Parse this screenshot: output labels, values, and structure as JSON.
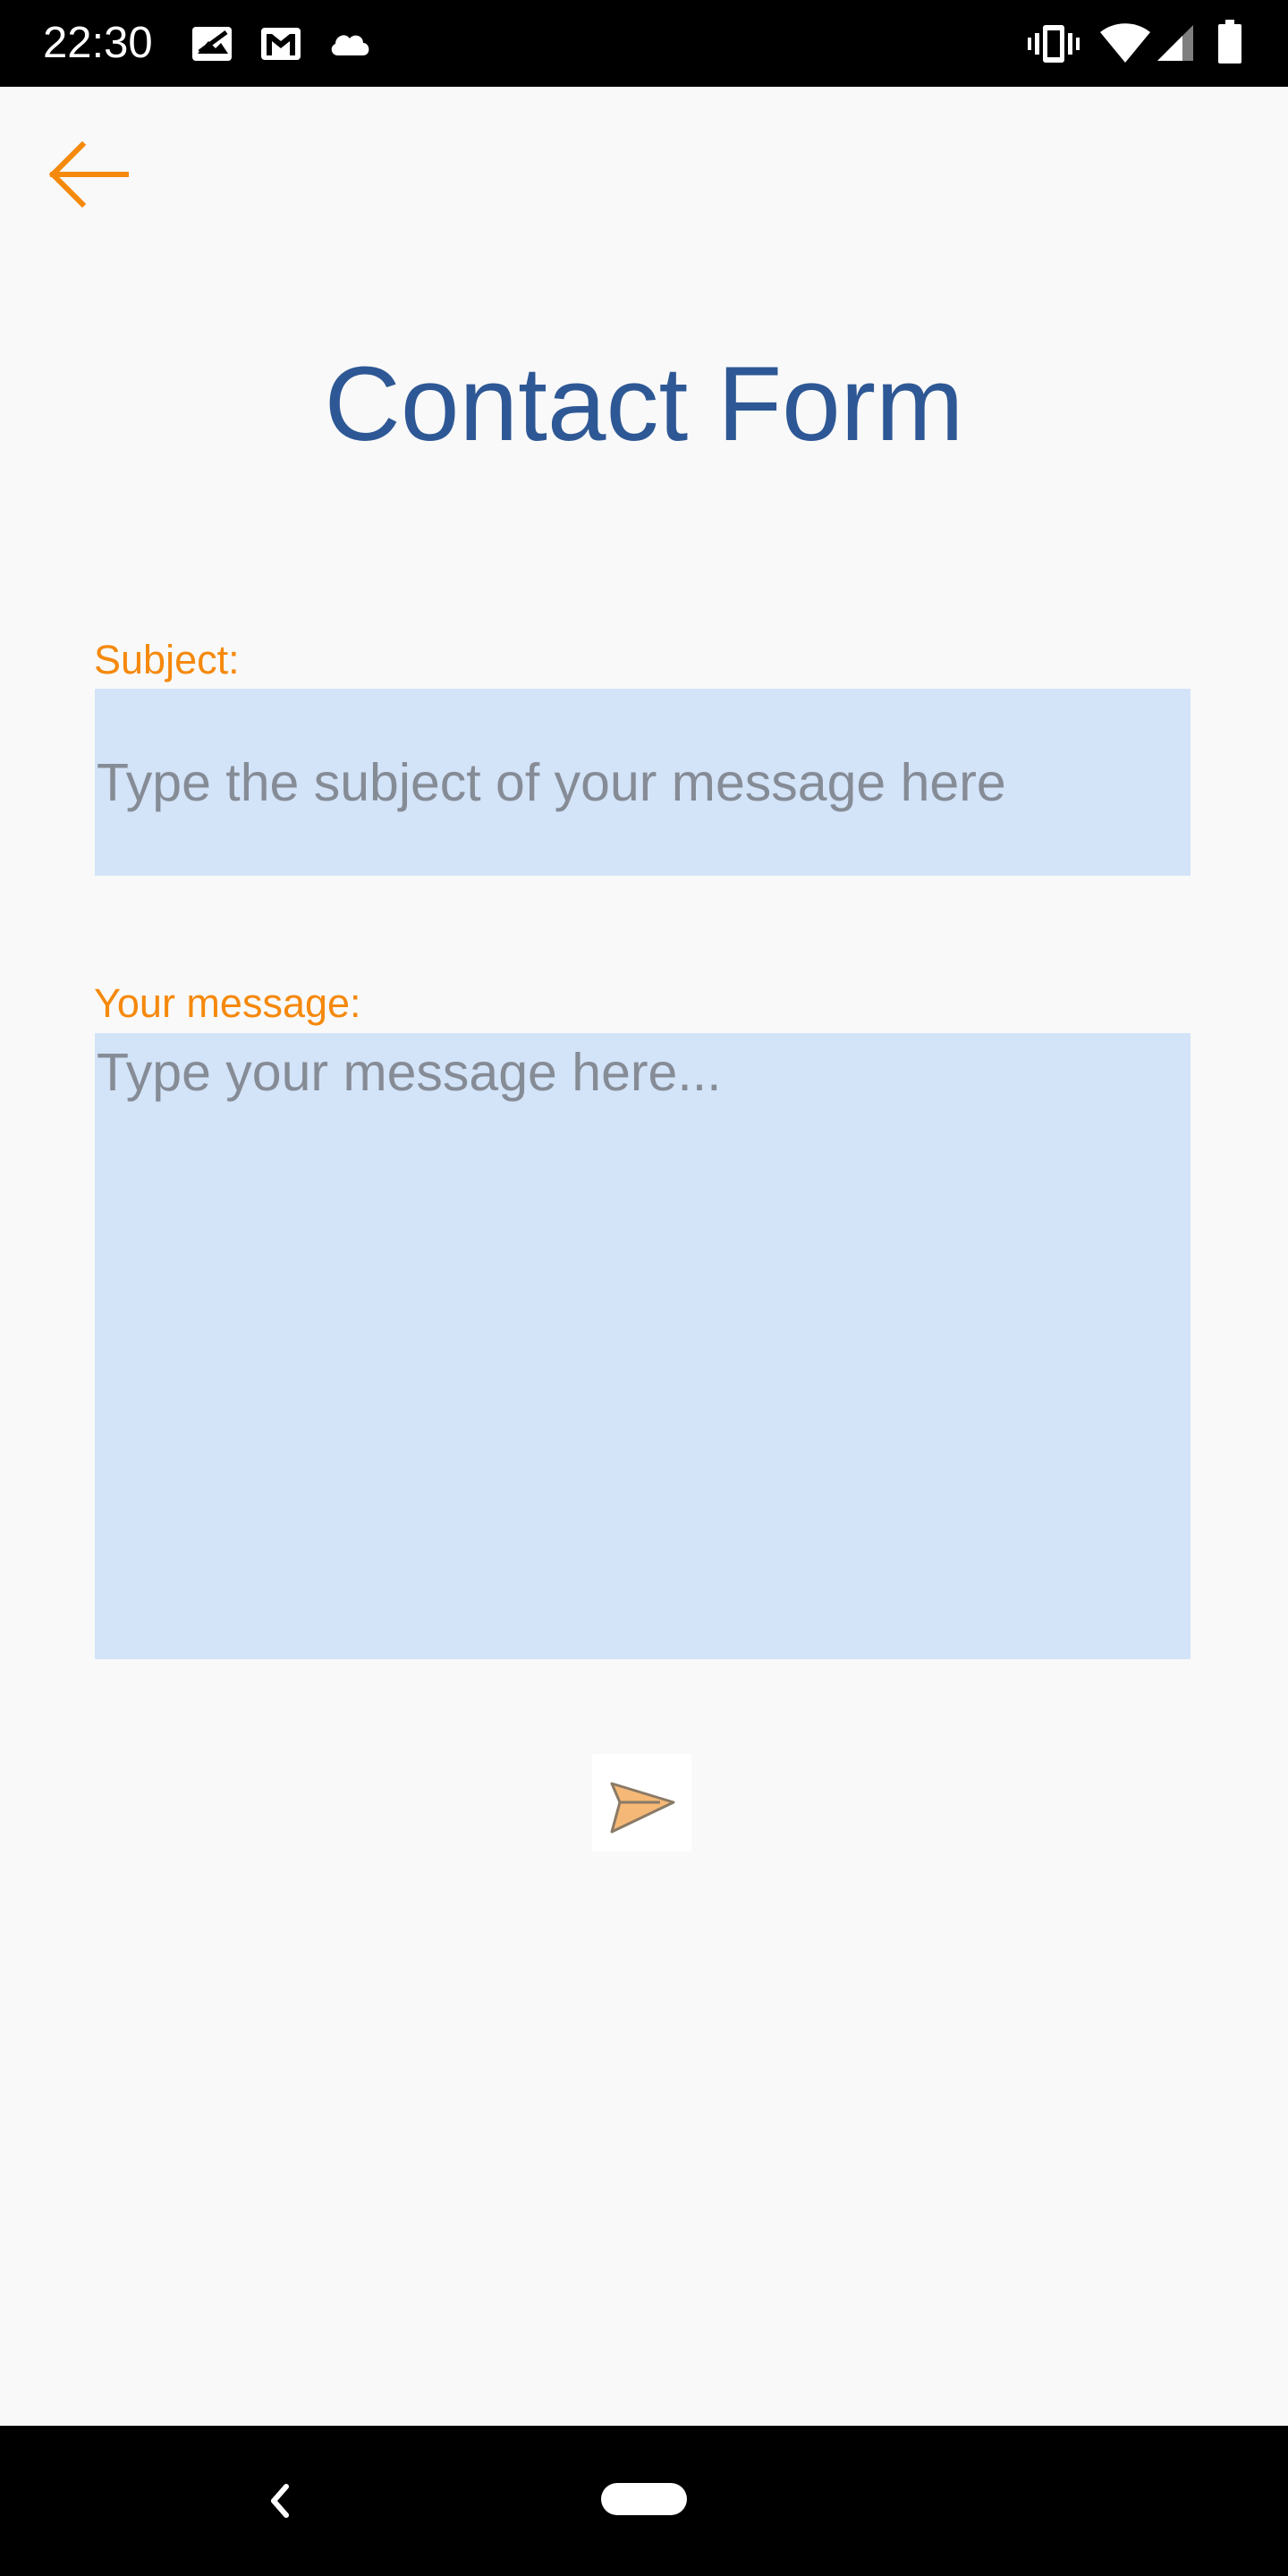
{
  "status_bar": {
    "time": "22:30",
    "left_icons": [
      "photo-notification-icon",
      "gmail-icon",
      "cloud-icon"
    ],
    "right_icons": [
      "vibrate-icon",
      "wifi-icon",
      "cell-signal-icon",
      "battery-icon"
    ]
  },
  "header": {
    "back_icon": "arrow-left-icon"
  },
  "form": {
    "title": "Contact Form",
    "subject_label": "Subject:",
    "subject_placeholder": "Type the subject of your message here",
    "subject_value": "",
    "message_label": "Your message:",
    "message_placeholder": "Type your message here...",
    "message_value": "",
    "send_icon": "paper-plane-icon"
  },
  "nav_bar": {
    "back_icon": "nav-back-icon",
    "home_icon": "home-pill-icon"
  },
  "colors": {
    "accent": "#f5890c",
    "title": "#2e5895",
    "input_background": "#d3e3f8",
    "placeholder": "#868c96",
    "send_icon_fill": "#f6b877"
  }
}
